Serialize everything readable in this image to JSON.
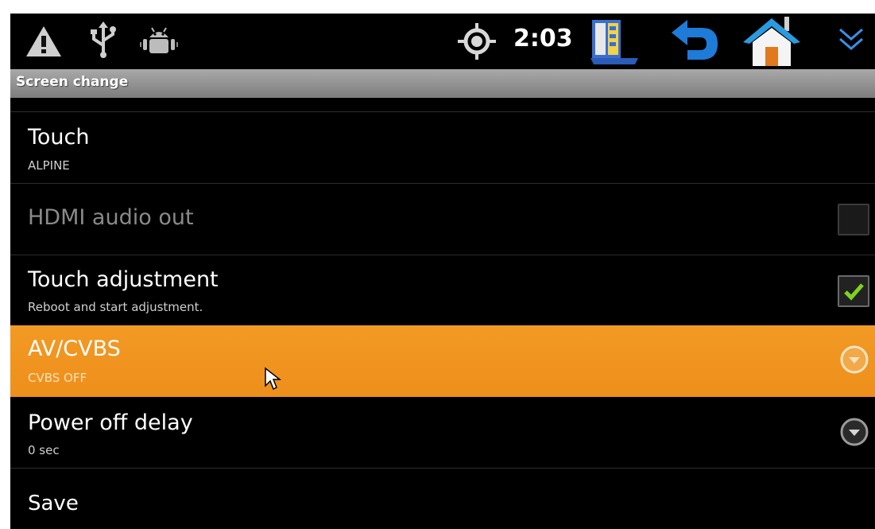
{
  "status_bar": {
    "time": "2:03",
    "icons": [
      "warning-icon",
      "usb-icon",
      "android-debug-icon",
      "gps-icon",
      "window-switch-icon",
      "back-icon",
      "home-icon",
      "expand-icon"
    ]
  },
  "title_bar": {
    "title": "Screen change"
  },
  "list": {
    "items": [
      {
        "title": "Touch",
        "subtitle": "ALPINE"
      },
      {
        "title": "HDMI audio out",
        "subtitle": "",
        "checked": false,
        "disabled": true
      },
      {
        "title": "Touch adjustment",
        "subtitle": "Reboot and start adjustment.",
        "checked": true
      },
      {
        "title": "AV/CVBS",
        "subtitle": "CVBS OFF",
        "selected": true
      },
      {
        "title": "Power off delay",
        "subtitle": "0 sec"
      },
      {
        "title": "Save",
        "subtitle": ""
      }
    ]
  },
  "colors": {
    "selected_row": "#ef921e",
    "title_bar": "#8e8e8e",
    "check_mark": "#7ed321",
    "back_arrow": "#1e7bd8",
    "home_roof": "#2a9be0"
  }
}
